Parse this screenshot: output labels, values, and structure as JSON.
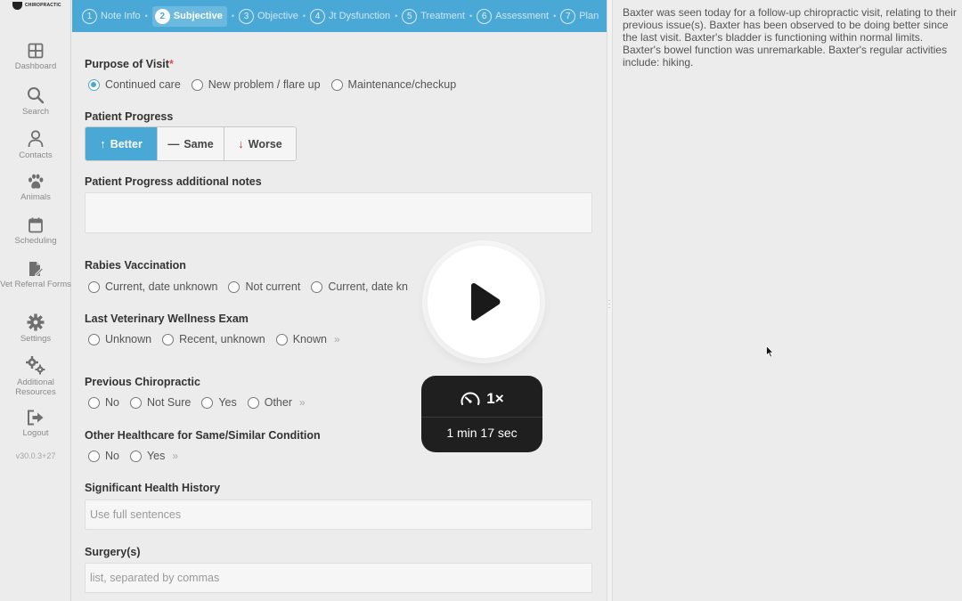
{
  "sidebar": {
    "logo_text": "CHIROPRACTIC",
    "items": [
      {
        "label": "Dashboard",
        "icon": "grid-icon"
      },
      {
        "label": "Search",
        "icon": "search-icon"
      },
      {
        "label": "Contacts",
        "icon": "person-icon"
      },
      {
        "label": "Animals",
        "icon": "paw-icon"
      },
      {
        "label": "Scheduling",
        "icon": "calendar-icon"
      },
      {
        "label": "Vet Referral Forms",
        "icon": "file-edit-icon"
      },
      {
        "label": "Settings",
        "icon": "gear-icon"
      },
      {
        "label": "Additional Resources",
        "icon": "gears-icon"
      },
      {
        "label": "Logout",
        "icon": "logout-icon"
      }
    ],
    "version": "v30.0.3+27"
  },
  "stepper": {
    "steps": [
      {
        "num": "1",
        "label": "Note Info"
      },
      {
        "num": "2",
        "label": "Subjective"
      },
      {
        "num": "3",
        "label": "Objective"
      },
      {
        "num": "4",
        "label": "Jt Dysfunction"
      },
      {
        "num": "5",
        "label": "Treatment"
      },
      {
        "num": "6",
        "label": "Assessment"
      },
      {
        "num": "7",
        "label": "Plan"
      }
    ],
    "active": "Subjective"
  },
  "form": {
    "purpose": {
      "label": "Purpose of Visit",
      "required_mark": "*",
      "options": [
        "Continued care",
        "New problem / flare up",
        "Maintenance/checkup"
      ],
      "selected": "Continued care"
    },
    "progress": {
      "label": "Patient Progress",
      "better": "Better",
      "same": "Same",
      "worse": "Worse",
      "better_arrow": "↑",
      "same_arrow": "—",
      "worse_arrow": "↓",
      "selected": "Better"
    },
    "progress_notes": {
      "label": "Patient Progress additional notes",
      "value": ""
    },
    "rabies": {
      "label": "Rabies Vaccination",
      "options": [
        "Current, date unknown",
        "Not current",
        "Current, date kn"
      ]
    },
    "wellness": {
      "label": "Last Veterinary Wellness Exam",
      "options": [
        "Unknown",
        "Recent, unknown",
        "Known"
      ]
    },
    "prev_chiro": {
      "label": "Previous Chiropractic",
      "options": [
        "No",
        "Not Sure",
        "Yes",
        "Other"
      ]
    },
    "other_healthcare": {
      "label": "Other Healthcare for Same/Similar Condition",
      "options": [
        "No",
        "Yes"
      ]
    },
    "health_history": {
      "label": "Significant Health History",
      "placeholder": "Use full sentences"
    },
    "surgery": {
      "label": "Surgery(s)",
      "placeholder": "list, separated by commas"
    }
  },
  "note": {
    "text": "Baxter was seen today for a follow-up chiropractic visit, relating to their previous issue(s). Baxter has been observed to be doing better since the last visit. Baxter's bladder is functioning within normal limits. Baxter's bowel function was unremarkable. Baxter's regular activities include: hiking."
  },
  "video": {
    "speed": "1×",
    "duration": "1 min 17 sec"
  },
  "colors": {
    "accent": "#4aa8d6",
    "worse_arrow": "#c0392b",
    "required": "#d9534f"
  }
}
